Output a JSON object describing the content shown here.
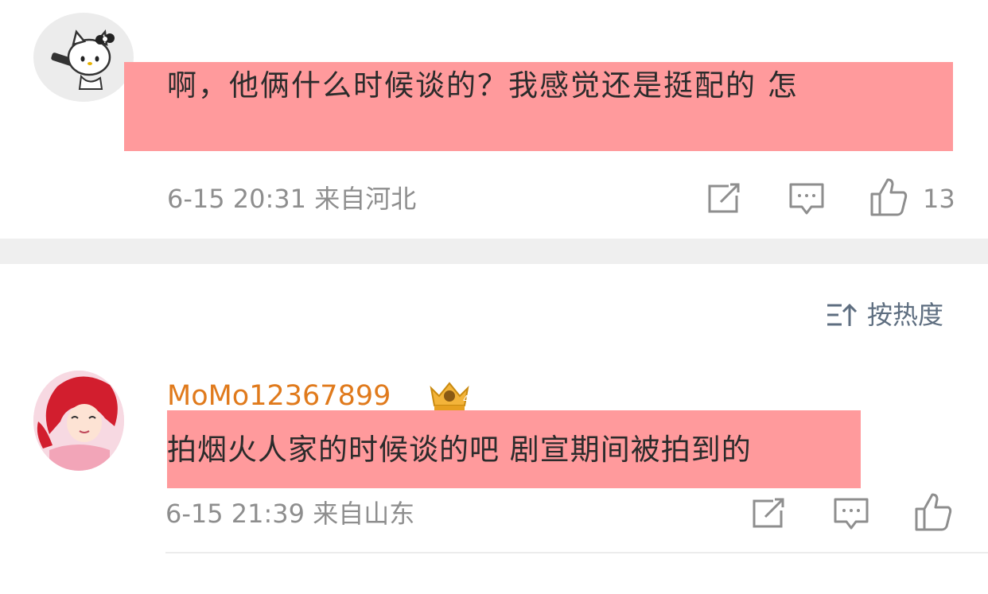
{
  "comments": [
    {
      "avatar": "hello-kitty-avatar",
      "text": "啊，他俩什么时候谈的？我感觉还是挺配的 怎",
      "meta": "6-15 20:31 来自河北",
      "like_count": "13",
      "highlight_color": "#ff9a9c"
    },
    {
      "avatar": "red-hair-cartoon-avatar",
      "username": "MoMo12367899",
      "badge": "crown-badge",
      "text": "拍烟火人家的时候谈的吧 剧宣期间被拍到的",
      "meta": "6-15 21:39 来自山东",
      "username_color": "#e07a1c",
      "highlight_color": "#ff9a9c"
    }
  ],
  "sort": {
    "label": "按热度",
    "icon": "sort-icon"
  },
  "actions": {
    "share_icon": "share-icon",
    "comment_icon": "comment-icon",
    "like_icon": "thumbs-up-icon"
  }
}
